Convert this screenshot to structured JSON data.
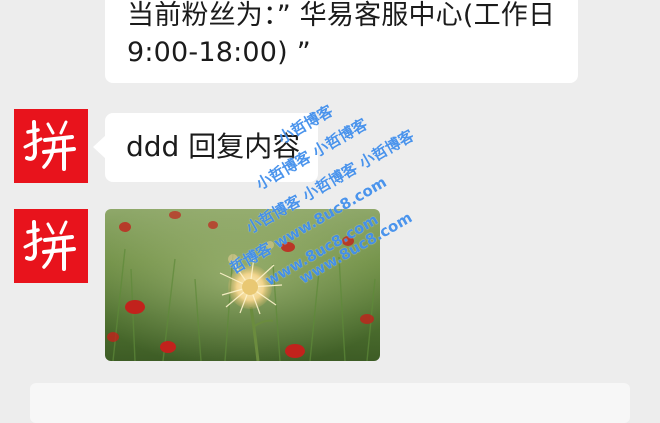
{
  "conversation": {
    "messages": [
      {
        "sender": "hi-avatar",
        "type": "text",
        "text": "当前粉丝为：” 华易客服中心(工作日 9:00-18:00) ”"
      },
      {
        "sender": "hi-avatar",
        "type": "text",
        "text": "ddd 回复内容"
      },
      {
        "sender": "hi-avatar",
        "type": "image",
        "image": "field-flowers-photo"
      }
    ]
  },
  "avatar": {
    "glyph": "拼",
    "background": "#e8131c"
  },
  "watermark": {
    "lines": [
      "小哲博客",
      "小哲博客 小哲博客",
      "小哲博客 小哲博客 小哲博客",
      "哲博客 www.8uc8.com",
      "www.8uc8.com",
      "www.8uc8.com"
    ]
  },
  "colors": {
    "page_bg": "#ededed",
    "bubble_bg": "#ffffff",
    "watermark": "#237ce8"
  }
}
